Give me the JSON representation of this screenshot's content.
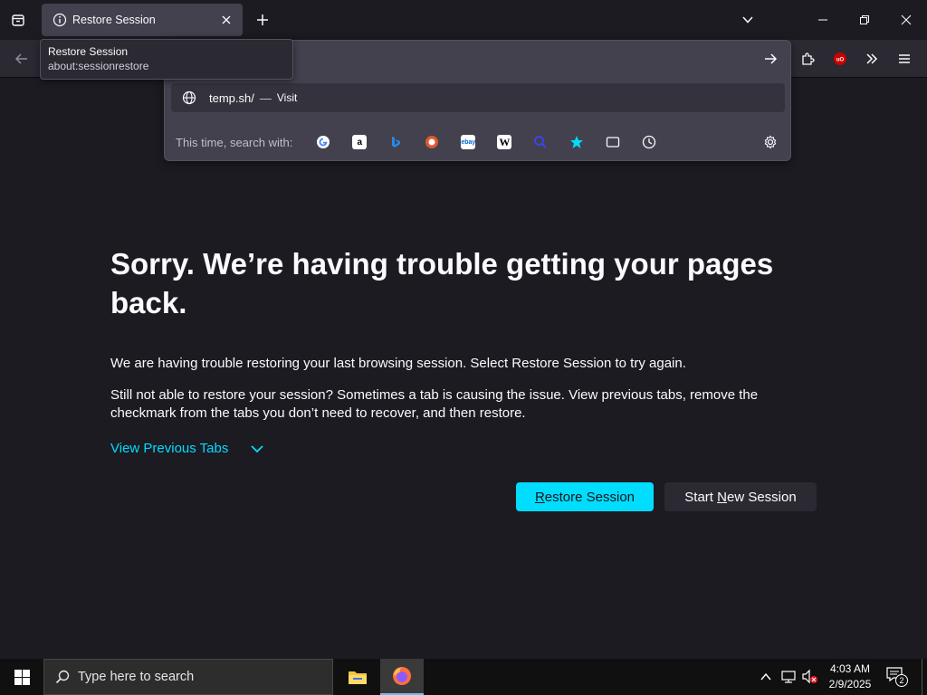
{
  "tab": {
    "title": "Restore Session"
  },
  "tooltip": {
    "title": "Restore Session",
    "url": "about:sessionrestore"
  },
  "urlbar": {
    "suggestion_url": "temp.sh/",
    "suggestion_sep": "—",
    "suggestion_action": "Visit",
    "oneoff_label": "This time, search with:",
    "engines": [
      "google-icon",
      "amazon-icon",
      "bing-icon",
      "duckduckgo-icon",
      "ebay-icon",
      "wikipedia-icon",
      "search-icon",
      "bookmarks-icon",
      "tabs-icon",
      "history-icon"
    ]
  },
  "main": {
    "heading": "Sorry. We’re having trouble getting your pages back.",
    "para1": "We are having trouble restoring your last browsing session. Select Restore Session to try again.",
    "para2": "Still not able to restore your session? Sometimes a tab is causing the issue. View previous tabs, remove the checkmark from the tabs you don’t need to recover, and then restore.",
    "view_previous": "View Previous Tabs",
    "restore_pre": "",
    "restore_u": "R",
    "restore_post": "estore Session",
    "new_pre": "Start ",
    "new_u": "N",
    "new_post": "ew Session"
  },
  "taskbar": {
    "search_placeholder": "Type here to search",
    "time": "4:03 AM",
    "date": "2/9/2025",
    "notif_count": "2"
  },
  "colors": {
    "accent": "#00ddff",
    "bg": "#1c1b22",
    "toolbar": "#2b2a33"
  }
}
